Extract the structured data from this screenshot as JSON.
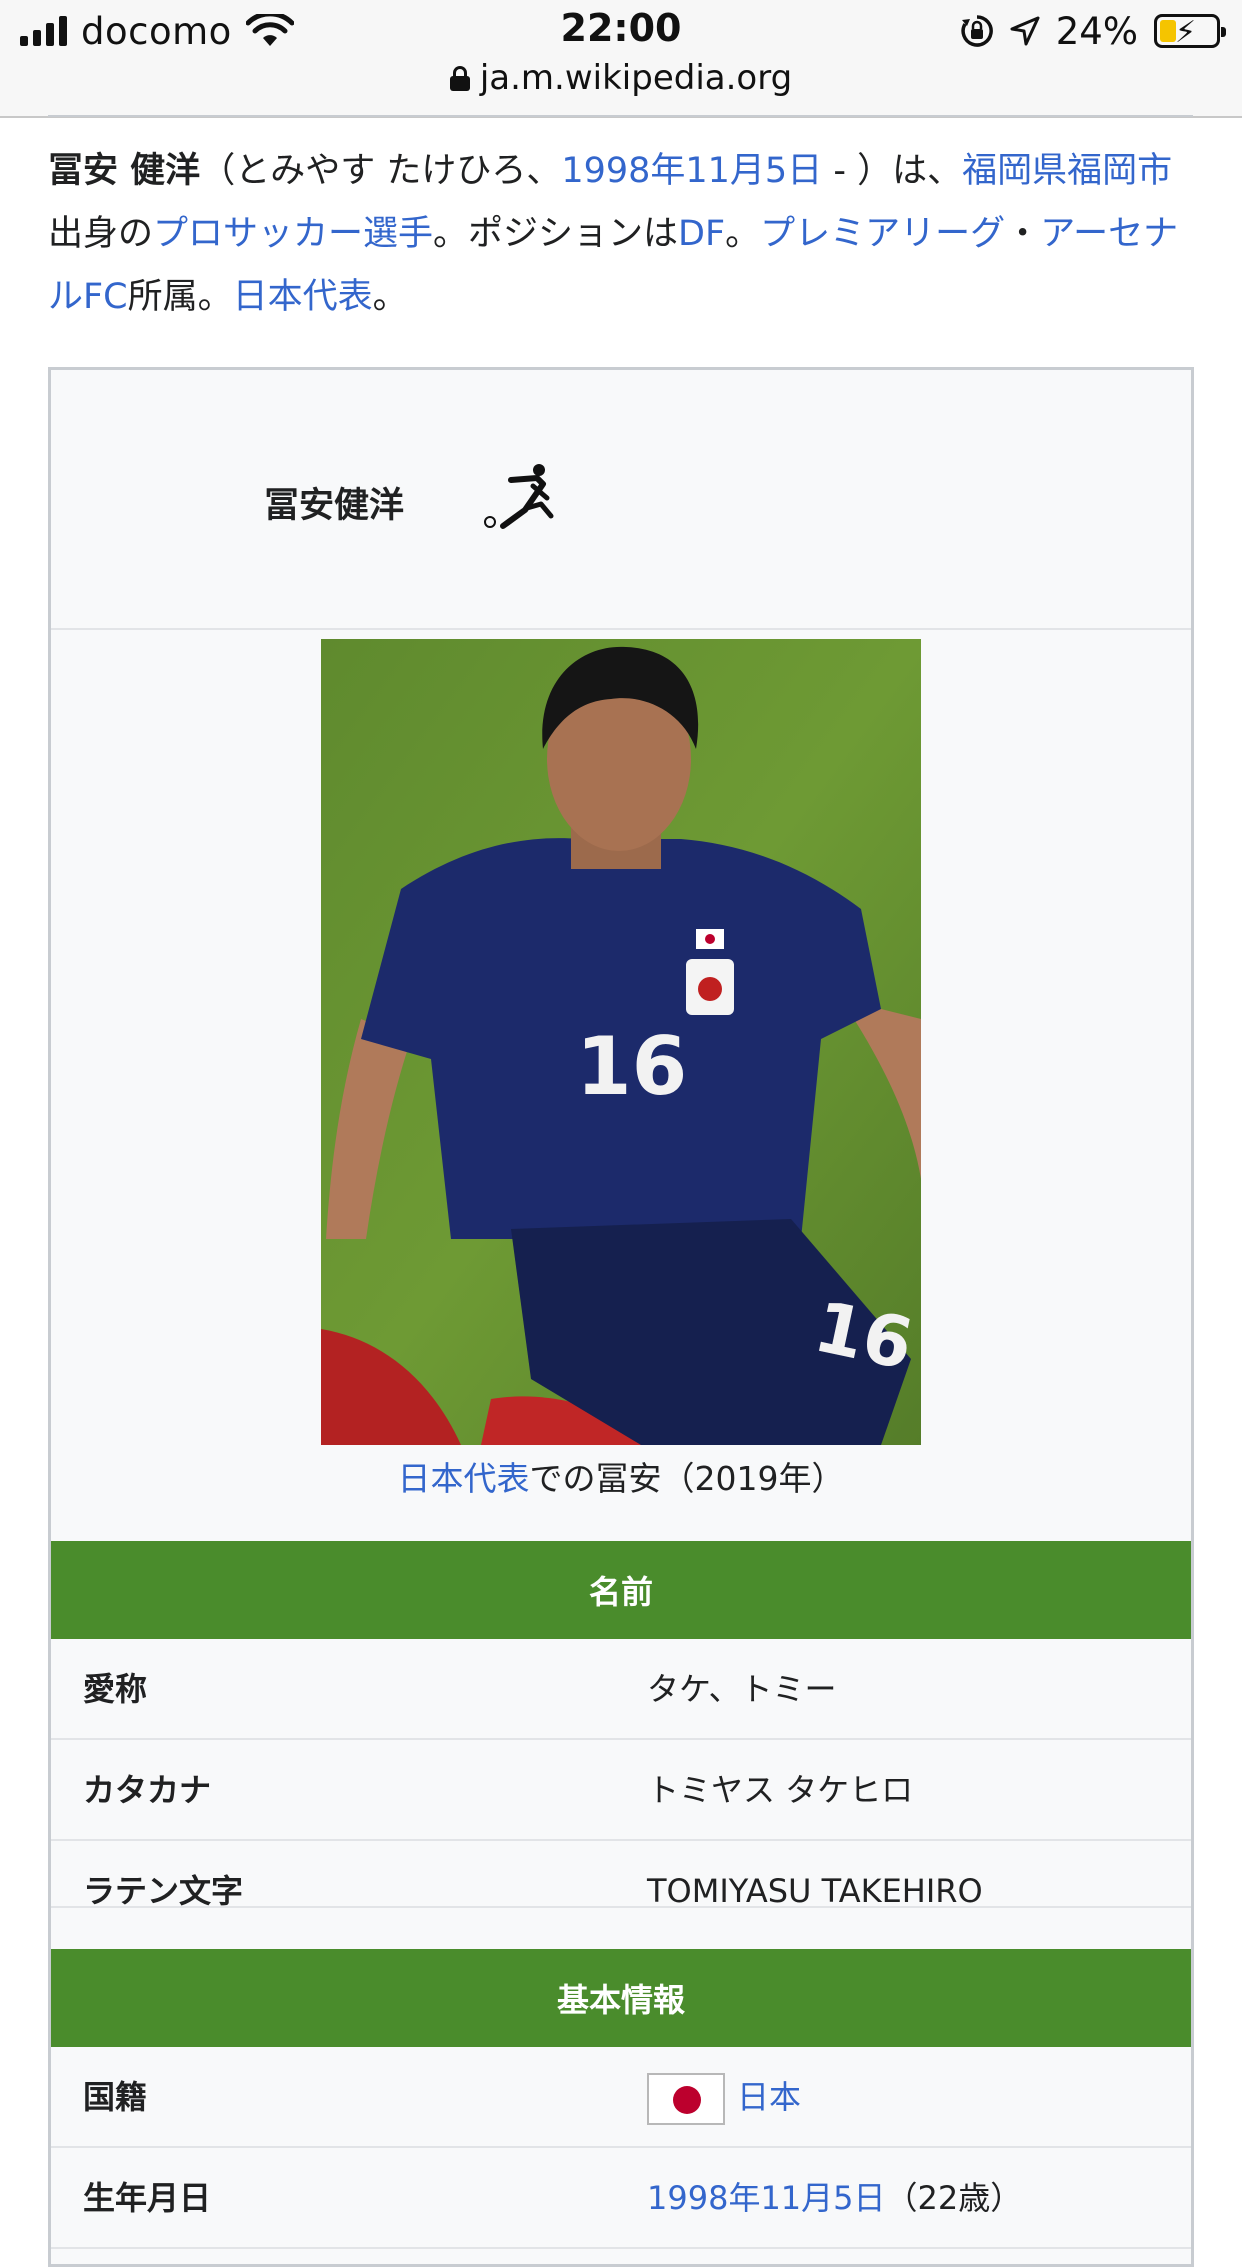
{
  "status_bar": {
    "carrier": "docomo",
    "time": "22:00",
    "battery_percent": "24%",
    "battery_level": 0.24,
    "url": "ja.m.wikipedia.org",
    "icons": [
      "signal-icon",
      "wifi-icon",
      "orientation-lock-icon",
      "location-arrow-icon",
      "battery-charging-icon",
      "lock-icon"
    ]
  },
  "lead": {
    "name_bold": "冨安 健洋",
    "reading_open": "（とみやす たけひろ、",
    "birth_link": "1998年11月5日",
    "reading_close": " - ）は、",
    "hometown_link": "福岡県福岡市",
    "t1": "出身の",
    "profession_link": "プロサッカー選手",
    "t2": "。ポジションは",
    "position_link": "DF",
    "t3": "。",
    "league_link": "プレミアリーグ",
    "t4": "・",
    "club_link": "アーセナルFC",
    "t5": "所属。",
    "national_link": "日本代表",
    "t6": "。"
  },
  "infobox": {
    "title": "冨安健洋",
    "title_icon": "football-kick-icon",
    "caption_link": "日本代表",
    "caption_text": "での冨安（2019年）",
    "section_name": "名前",
    "rows_name": [
      {
        "key": "愛称",
        "value": "タケ、トミー"
      },
      {
        "key": "カタカナ",
        "value": "トミヤス タケヒロ"
      },
      {
        "key": "ラテン文字",
        "value": "TOMIYASU TAKEHIRO"
      }
    ],
    "section_basic": "基本情報",
    "nationality": {
      "key": "国籍",
      "value_link": "日本",
      "flag_icon": "japan-flag-icon"
    },
    "birthdate": {
      "key": "生年月日",
      "value_link": "1998年11月5日",
      "value_suffix": "（22歳）"
    },
    "colors": {
      "section_green": "#4a8c2c",
      "link_blue": "#3366cc",
      "flag_red": "#bc002d"
    }
  }
}
